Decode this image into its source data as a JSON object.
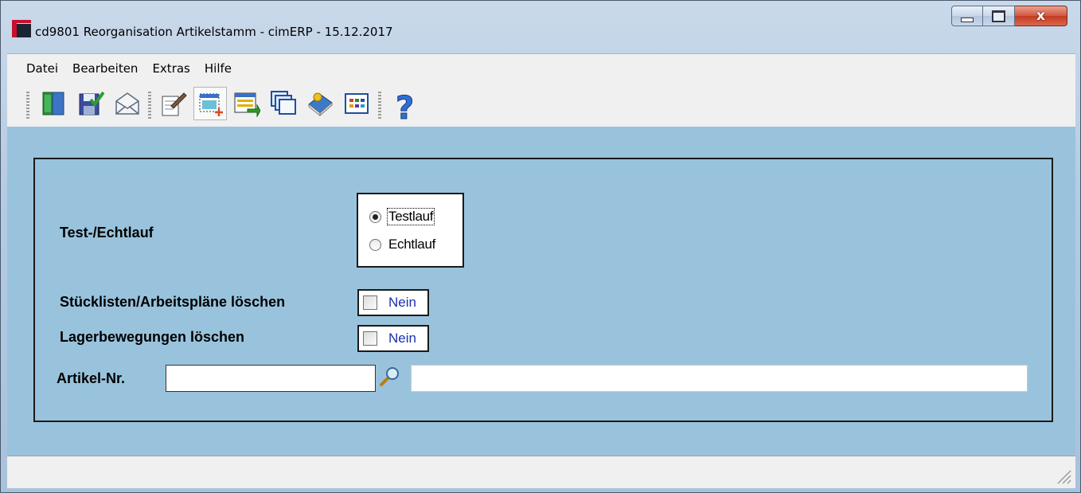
{
  "window": {
    "title": "cd9801 Reorganisation Artikelstamm - cimERP - 15.12.2017",
    "close_label": "x"
  },
  "menu": {
    "items": [
      "Datei",
      "Bearbeiten",
      "Extras",
      "Hilfe"
    ]
  },
  "toolbar": {
    "buttons": [
      "exit-icon",
      "save-check-icon",
      "mail-icon",
      "edit-icon",
      "new-window-icon",
      "transfer-icon",
      "windows-icon",
      "book-icon",
      "grid-icon",
      "help-icon"
    ],
    "help_label": "?"
  },
  "form": {
    "mode_label": "Test-/Echtlauf",
    "mode_options": [
      "Testlauf",
      "Echtlauf"
    ],
    "mode_selected": "Testlauf",
    "bom_label": "Stücklisten/Arbeitspläne löschen",
    "bom_value": "Nein",
    "stock_label": "Lagerbewegungen löschen",
    "stock_value": "Nein",
    "article_label": "Artikel-Nr.",
    "article_value": "",
    "article_desc_value": ""
  },
  "colors": {
    "form_background": "#99c3dc",
    "checkbox_text": "#1a2fb0"
  }
}
